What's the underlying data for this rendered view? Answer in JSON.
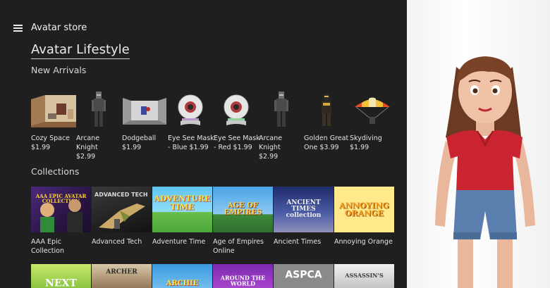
{
  "header": {
    "title": "Avatar store"
  },
  "section": {
    "title": "Avatar Lifestyle"
  },
  "new_arrivals": {
    "heading": "New Arrivals",
    "items": [
      {
        "name": "Cozy Space",
        "price": "$1.99"
      },
      {
        "name": "Arcane Knight",
        "price": "$2.99"
      },
      {
        "name": "Dodgeball",
        "price": "$1.99"
      },
      {
        "name": "Eye See Mask - Blue",
        "price": "$1.99"
      },
      {
        "name": "Eye See Mask - Red",
        "price": "$1.99"
      },
      {
        "name": "Arcane Knight",
        "price": "$2.99"
      },
      {
        "name": "Golden Great One",
        "price": "$3.99"
      },
      {
        "name": "Skydiving",
        "price": "$1.99"
      }
    ]
  },
  "collections": {
    "heading": "Collections",
    "items": [
      {
        "name": "AAA Epic Collection",
        "art_text": "AAA EPIC AVATAR COLLECTION"
      },
      {
        "name": "Advanced Tech",
        "art_text": "ADVANCED TECH"
      },
      {
        "name": "Adventure Time",
        "art_text": "ADVENTURE TIME"
      },
      {
        "name": "Age of Empires Online",
        "art_text": "AGE OF EMPIRES"
      },
      {
        "name": "Ancient Times",
        "art_text": "ANCIENT TIMES collection"
      },
      {
        "name": "Annoying Orange",
        "art_text": "ANNOYING ORANGE"
      }
    ],
    "row2_art": [
      "NEXT",
      "ARCHER",
      "ARCHIE",
      "AROUND THE WORLD",
      "ASPCA",
      "ASSASSIN'S"
    ]
  },
  "colors": {
    "background": "#1f1f1f",
    "text": "#e6e6e6",
    "preview_bg": "#f4f4f4"
  }
}
